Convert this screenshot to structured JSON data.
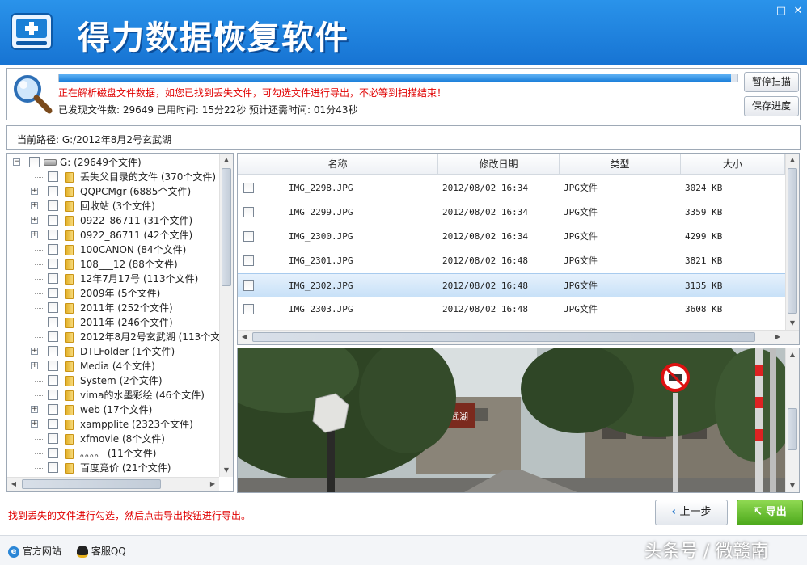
{
  "app": {
    "title": "得力数据恢复软件",
    "window_controls": [
      "–",
      "□",
      "✕"
    ]
  },
  "scan": {
    "progress_percent": 99,
    "message": "正在解析磁盘文件数据，如您已找到丢失文件，可勾选文件进行导出，不必等到扫描结束！",
    "stats": "已发现文件数: 29649  已用时间: 15分22秒  预计还需时间: 01分43秒",
    "pause_label": "暂停扫描",
    "save_label": "保存进度"
  },
  "path": {
    "label": "当前路径:  G:/2012年8月2号玄武湖"
  },
  "tree": {
    "root": "G:  (29649个文件)",
    "items": [
      {
        "label": "丢失父目录的文件  (370个文件)",
        "expandable": false
      },
      {
        "label": "QQPCMgr  (6885个文件)",
        "expandable": true
      },
      {
        "label": "回收站  (3个文件)",
        "expandable": true
      },
      {
        "label": "0922_86711  (31个文件)",
        "expandable": true
      },
      {
        "label": "0922_86711  (42个文件)",
        "expandable": true
      },
      {
        "label": "100CANON  (84个文件)",
        "expandable": false
      },
      {
        "label": "108___12  (88个文件)",
        "expandable": false
      },
      {
        "label": "12年7月17号  (113个文件)",
        "expandable": false
      },
      {
        "label": "2009年  (5个文件)",
        "expandable": false
      },
      {
        "label": "2011年  (252个文件)",
        "expandable": false
      },
      {
        "label": "2011年  (246个文件)",
        "expandable": false
      },
      {
        "label": "2012年8月2号玄武湖  (113个文",
        "expandable": false
      },
      {
        "label": "DTLFolder  (1个文件)",
        "expandable": true
      },
      {
        "label": "Media  (4个文件)",
        "expandable": true
      },
      {
        "label": "System  (2个文件)",
        "expandable": false
      },
      {
        "label": "vima的水墨彩绘  (46个文件)",
        "expandable": false
      },
      {
        "label": "web  (17个文件)",
        "expandable": true
      },
      {
        "label": "xampplite  (2323个文件)",
        "expandable": true
      },
      {
        "label": "xfmovie  (8个文件)",
        "expandable": false
      },
      {
        "label": "。。。。  (11个文件)",
        "expandable": false
      },
      {
        "label": "百度竞价  (21个文件)",
        "expandable": false
      }
    ]
  },
  "files": {
    "columns": [
      "名称",
      "修改日期",
      "类型",
      "大小"
    ],
    "rows": [
      {
        "name": "IMG_2298.JPG",
        "date": "2012/08/02 16:34",
        "type": "JPG文件",
        "size": "3024 KB",
        "selected": false
      },
      {
        "name": "IMG_2299.JPG",
        "date": "2012/08/02 16:34",
        "type": "JPG文件",
        "size": "3359 KB",
        "selected": false
      },
      {
        "name": "IMG_2300.JPG",
        "date": "2012/08/02 16:34",
        "type": "JPG文件",
        "size": "4299 KB",
        "selected": false
      },
      {
        "name": "IMG_2301.JPG",
        "date": "2012/08/02 16:48",
        "type": "JPG文件",
        "size": "3821 KB",
        "selected": false
      },
      {
        "name": "IMG_2302.JPG",
        "date": "2012/08/02 16:48",
        "type": "JPG文件",
        "size": "3135 KB",
        "selected": true
      },
      {
        "name": "IMG_2303.JPG",
        "date": "2012/08/02 16:48",
        "type": "JPG文件",
        "size": "3608 KB",
        "selected": false
      }
    ]
  },
  "preview": {
    "sign_text": "玄武湖"
  },
  "bottom": {
    "hint": "找到丢失的文件进行勾选，然后点击导出按钮进行导出。",
    "back_label": "上一步",
    "export_label": "导出"
  },
  "footer": {
    "website_label": "官方网站",
    "qq_label": "客服QQ",
    "watermark": "头条号 / 微赣南",
    "version": "1"
  },
  "colors": {
    "title_bar": "#1e84df",
    "hint_red": "#e00000",
    "selected_row": "#c8e1f8",
    "export_green": "#5bb526"
  }
}
